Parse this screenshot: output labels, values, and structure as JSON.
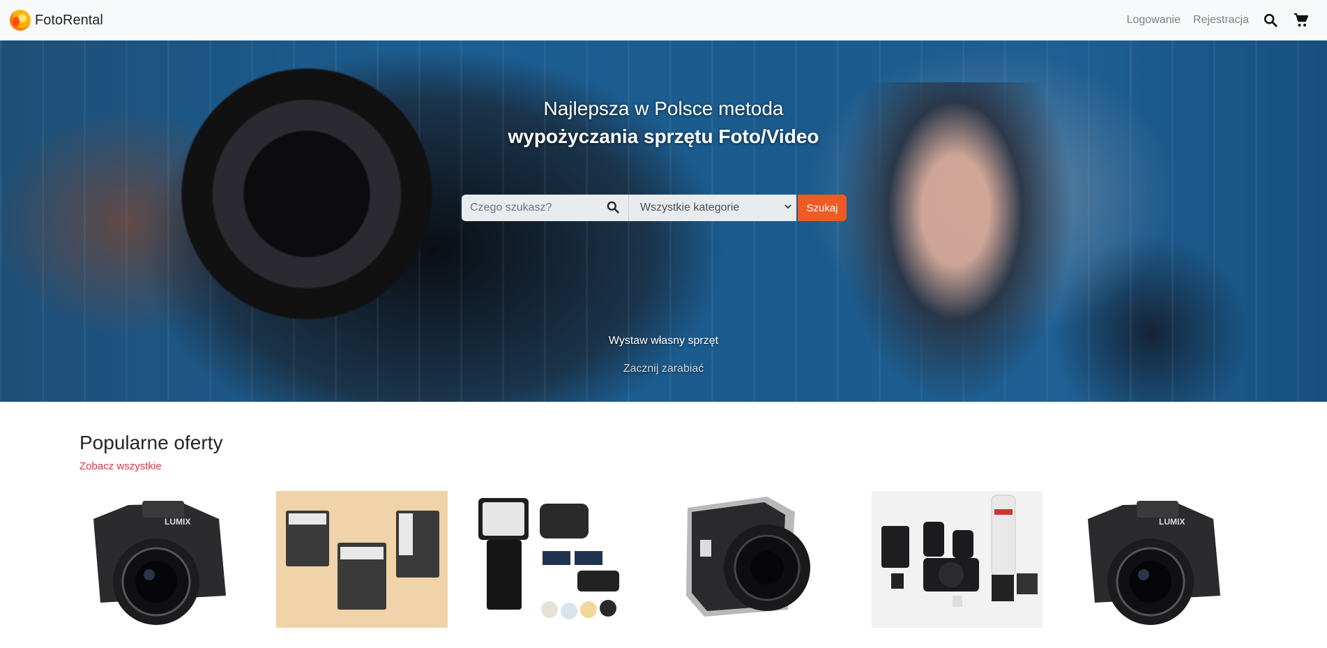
{
  "navbar": {
    "brand": "FotoRental",
    "login": "Logowanie",
    "register": "Rejestracja",
    "icons": [
      "search-icon",
      "cart-icon"
    ]
  },
  "hero": {
    "title_line1": "Najlepsza w Polsce metoda",
    "title_line2": "wypożyczania sprzętu Foto/Video",
    "search_placeholder": "Czego szukasz?",
    "category_selected": "Wszystkie kategorie",
    "search_button": "Szukaj",
    "list_own": "Wystaw własny sprzęt",
    "start_earning": "Zacznij zarabiać"
  },
  "popular": {
    "title": "Popularne oferty",
    "see_all": "Zobacz wszystkie",
    "items": [
      {
        "kind": "camera-lumix"
      },
      {
        "kind": "sandbox-cards"
      },
      {
        "kind": "flash-kit"
      },
      {
        "kind": "hasselblad-camera"
      },
      {
        "kind": "sony-kit"
      },
      {
        "kind": "camera-lumix"
      }
    ]
  },
  "colors": {
    "accent": "#f05a24",
    "link_red": "#dc3545",
    "navbar_bg": "#f8f9fa"
  }
}
